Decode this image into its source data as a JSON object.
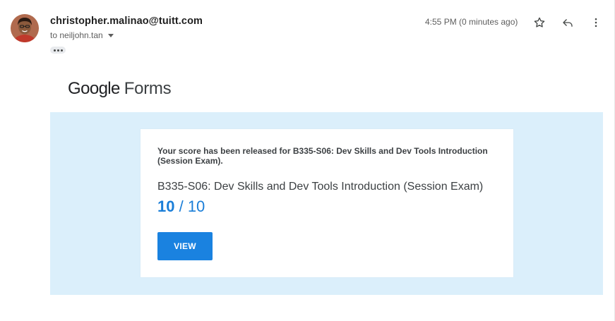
{
  "email": {
    "sender": "christopher.malinao@tuitt.com",
    "recipient": "to neiljohn.tan",
    "timestamp": "4:55 PM (0 minutes ago)",
    "icons": {
      "avatar": "avatar",
      "star": "star-icon",
      "reply": "reply-icon",
      "menu": "more-vert-icon",
      "more": "more-horiz-icon",
      "recipient_caret": "caret-down-icon"
    }
  },
  "body": {
    "logo": {
      "brand": "Google",
      "product": "Forms"
    },
    "card": {
      "headline": "Your score has been released for B335-S06: Dev Skills and Dev Tools Introduction (Session Exam).",
      "exam_title": "B335-S06: Dev Skills and Dev Tools Introduction (Session Exam)",
      "score_got": "10",
      "score_rest": " / 10",
      "view_label": "VIEW"
    }
  },
  "colors": {
    "banner": "#dbeffb",
    "accent": "#1a82e0",
    "score": "#1a7ed8",
    "text": "#3c4043"
  }
}
